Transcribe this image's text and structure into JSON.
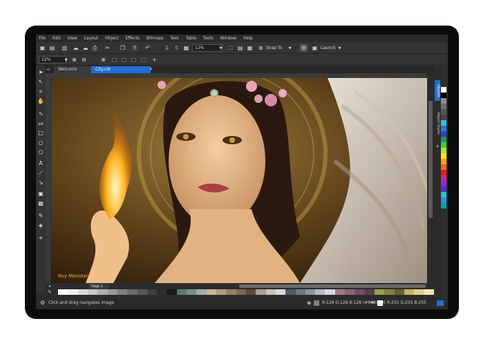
{
  "menu": [
    "File",
    "Edit",
    "View",
    "Layout",
    "Object",
    "Effects",
    "Bitmaps",
    "Text",
    "Table",
    "Tools",
    "Window",
    "Help"
  ],
  "toolbar": {
    "zoom_value": "12%",
    "snap_to_label": "Snap To",
    "launch_label": "Launch"
  },
  "propbar": {
    "zoom_value": "12%"
  },
  "tabs": {
    "welcome": "Welcome Screen",
    "document": "City.cdr"
  },
  "dock": {
    "tab1": "Objects",
    "tab2": "Object Styles"
  },
  "canvas": {
    "watermark": "Roy Monster"
  },
  "pagebar": {
    "page_label": "Page 1"
  },
  "status": {
    "hint": "Click and drag navigates image",
    "fill_info": "R:128 G:128 B:128 (#808080)",
    "outline_info": "R:255 G:255 B:255 (#FFFFFF)"
  },
  "colors": {
    "accent": "#1f6fd6",
    "bezel": "#0b0b0b",
    "chrome": "#333333"
  },
  "palette_vertical": [
    "#ffffff",
    "#000000",
    "#8a8a8a",
    "#6e6e6e",
    "#555",
    "#444",
    "#2ec4d8",
    "#1f7fd6",
    "#2b3fd0",
    "#16a34a",
    "#3bd03b",
    "#b6e23b",
    "#ffe600",
    "#f5a30a",
    "#f06a0a",
    "#e11d1d",
    "#d61f8c",
    "#8e2bd0",
    "#5b2bd0",
    "#1ec7c7",
    "#3a8be0",
    "#0aa0a0"
  ],
  "palette_horizontal": [
    "#ffffff",
    "#f2f2f2",
    "#dcdcdc",
    "#c8c8c8",
    "#b0b0b0",
    "#9a9a9a",
    "#808080",
    "#6a6a6a",
    "#555",
    "#404040",
    "#2e2e2e",
    "#1a1a1a",
    "#5c7a6d",
    "#7a8f86",
    "#9fb0a9",
    "#c9b49b",
    "#b59b80",
    "#9b7f66",
    "#7d6450",
    "#5e4a3b",
    "#a8a39a",
    "#c9c4bb",
    "#e0dcd4",
    "#4f5966",
    "#6b7684",
    "#8b96a3",
    "#b4bcc6",
    "#d5dae0",
    "#a07a88",
    "#8c6474",
    "#734f5f",
    "#5b3d4b",
    "#9aa04f",
    "#7d833d",
    "#60652e",
    "#c4b25e",
    "#e0d08a",
    "#f0e6b8"
  ]
}
